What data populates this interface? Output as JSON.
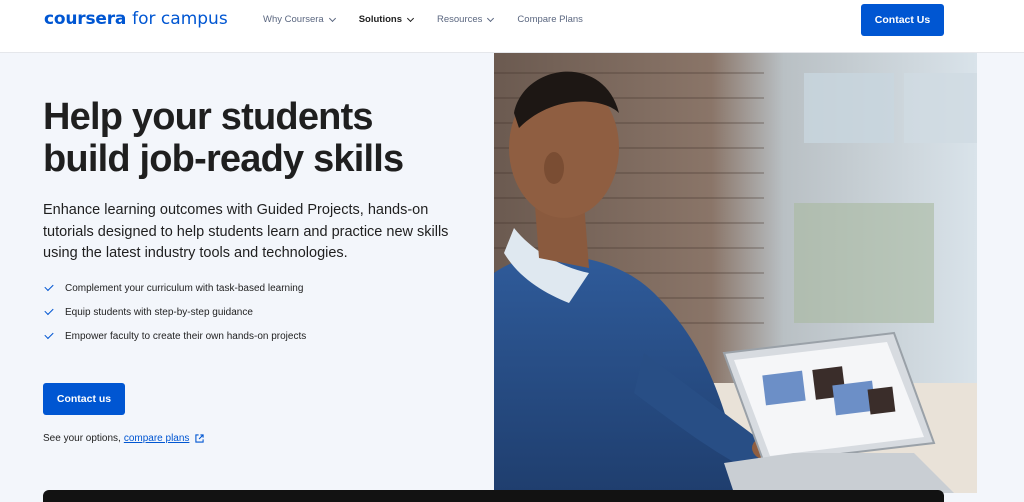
{
  "header": {
    "logo_brand": "coursera",
    "logo_suffix": "for campus",
    "nav": [
      {
        "label": "Why Coursera",
        "has_dropdown": true,
        "active": false
      },
      {
        "label": "Solutions",
        "has_dropdown": true,
        "active": true
      },
      {
        "label": "Resources",
        "has_dropdown": true,
        "active": false
      },
      {
        "label": "Compare Plans",
        "has_dropdown": false,
        "active": false
      }
    ],
    "contact_button": "Contact Us"
  },
  "hero": {
    "headline_line1": "Help your students",
    "headline_line2": "build job-ready skills",
    "lead": "Enhance learning outcomes with Guided Projects, hands-on tutorials designed to help students learn and practice new skills using the latest industry tools and technologies.",
    "bullets": [
      "Complement your curriculum with task-based learning",
      "Equip students with step-by-step guidance",
      "Empower faculty to create their own hands-on projects"
    ],
    "cta_label": "Contact us",
    "options_prefix": "See your options,",
    "options_link": "compare plans",
    "image_icon": "student-at-laptop-photo"
  },
  "colors": {
    "primary": "#0056d2",
    "hero_bg": "#f3f6fb",
    "text": "#1f1f1f"
  }
}
